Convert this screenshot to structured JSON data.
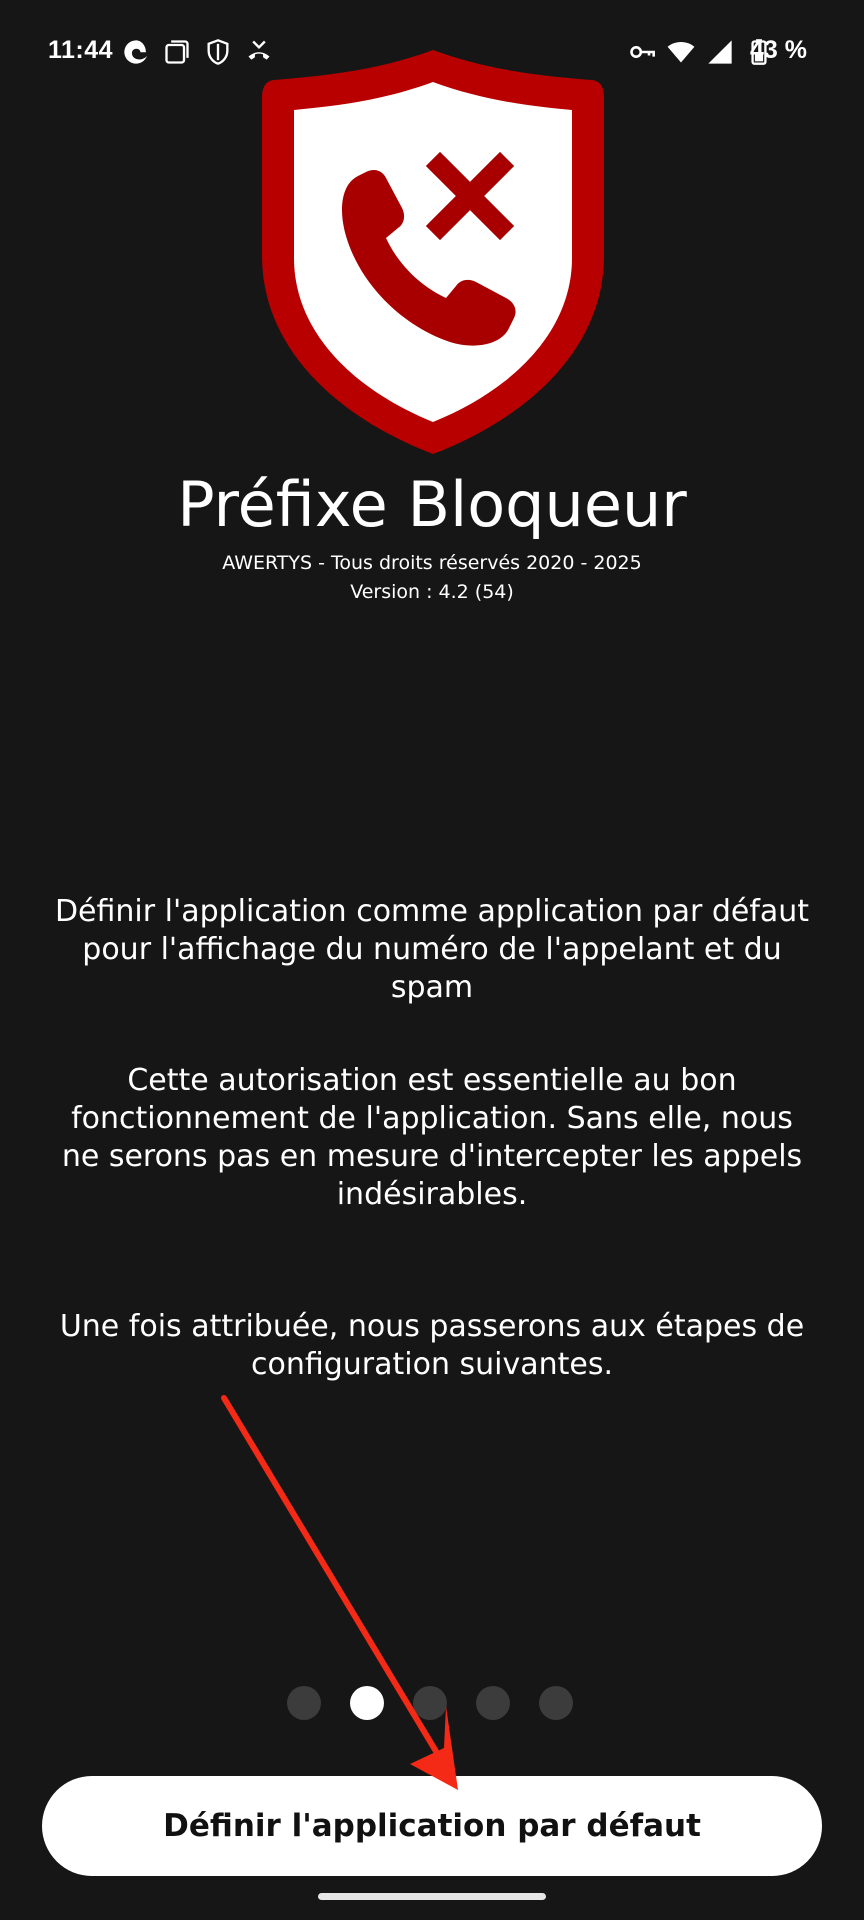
{
  "status_bar": {
    "time": "11:44",
    "battery": "43 %",
    "left_icons": [
      "edge-browser-icon",
      "screenshot-icon",
      "vpn-shield-icon",
      "call-forward-icon"
    ],
    "right_icons": [
      "vpn-key-icon",
      "wifi-icon",
      "cell-signal-icon",
      "battery-icon"
    ]
  },
  "app": {
    "title": "Préfixe Bloqueur",
    "copyright": "AWERTYS - Tous droits réservés 2020 - 2025",
    "version": "Version : 4.2 (54)",
    "logo_icon": "shield-blocked-call-icon",
    "brand_red": "#b30000"
  },
  "content": {
    "paragraph_1_line_1": "Définir l'application comme application par défaut",
    "paragraph_1_line_2": "pour l'affichage du numéro de l'appelant et du spam",
    "paragraph_2_line_1": "Cette autorisation est essentielle au bon",
    "paragraph_2_line_2": "fonctionnement de l'application. Sans elle, nous",
    "paragraph_2_line_3": "ne serons pas en mesure d'intercepter les appels",
    "paragraph_2_line_4": "indésirables.",
    "paragraph_3_line_1": "Une fois attribuée, nous passerons aux étapes de",
    "paragraph_3_line_2": "configuration suivantes."
  },
  "pager": {
    "total_pages": 5,
    "current_page": 2
  },
  "primary_button": {
    "label": "Définir l'application par défaut"
  },
  "annotation": {
    "arrow_color": "#f42a16"
  }
}
